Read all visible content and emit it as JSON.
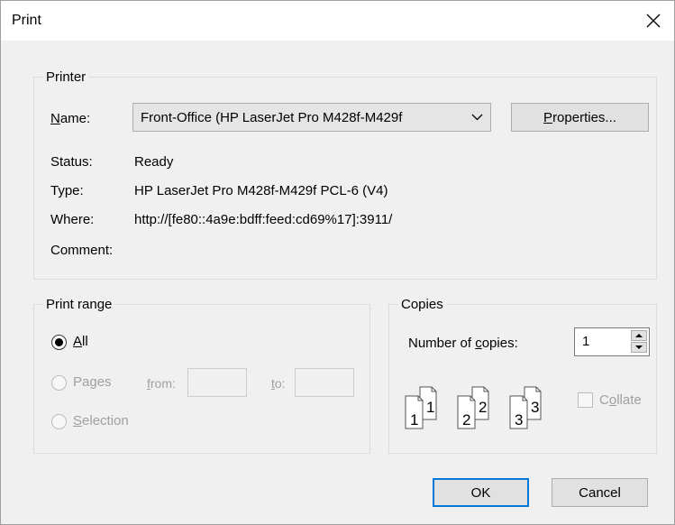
{
  "window": {
    "title": "Print"
  },
  "printer": {
    "legend": "Printer",
    "name_label_pre": "",
    "name_label_u": "N",
    "name_label_post": "ame:",
    "selected_printer": "Front-Office (HP LaserJet Pro M428f-M429f",
    "properties_u": "P",
    "properties_post": "roperties...",
    "status_label": "Status:",
    "status_value": "Ready",
    "type_label": "Type:",
    "type_value": "HP LaserJet Pro M428f-M429f PCL-6 (V4)",
    "where_label": "Where:",
    "where_value": "http://[fe80::4a9e:bdff:feed:cd69%17]:3911/",
    "comment_label": "Comment:"
  },
  "print_range": {
    "legend": "Print range",
    "all_u": "A",
    "all_post": "ll",
    "pages_pre": "Pa",
    "pages_u": "g",
    "pages_post": "es",
    "from_u": "f",
    "from_post": "rom:",
    "to_u": "t",
    "to_post": "o:",
    "selection_u": "S",
    "selection_post": "election",
    "selected": "All"
  },
  "copies": {
    "legend": "Copies",
    "number_pre": "Number of ",
    "number_u": "c",
    "number_post": "opies:",
    "count": "1",
    "collate_pre": "C",
    "collate_u": "o",
    "collate_post": "llate",
    "collate_checked": false,
    "collate_icon_digits": [
      "1",
      "1",
      "2",
      "2",
      "3",
      "3"
    ]
  },
  "buttons": {
    "ok": "OK",
    "cancel": "Cancel"
  },
  "icons": {
    "close": "close-icon",
    "dropdown": "chevron-down-icon"
  }
}
